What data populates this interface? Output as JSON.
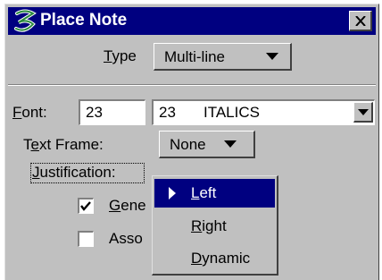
{
  "window": {
    "title": "Place Note",
    "brand_color": "#000080"
  },
  "type_row": {
    "label_accel": "T",
    "label_rest": "ype",
    "value": "Multi-line"
  },
  "font_row": {
    "label_accel": "F",
    "label_rest": "ont:",
    "number": "23",
    "font_number": "23",
    "font_name": "ITALICS"
  },
  "text_frame": {
    "label_pre": "T",
    "label_accel": "e",
    "label_rest": "xt Frame:",
    "value": "None"
  },
  "justification": {
    "label_accel": "J",
    "label_rest": "ustification:"
  },
  "checkboxes": [
    {
      "label_accel": "G",
      "label_rest": "ene",
      "checked": true
    },
    {
      "label_accel": "",
      "label_rest": "Asso",
      "checked": false
    }
  ],
  "menu": {
    "items": [
      {
        "accel": "L",
        "rest": "eft",
        "selected": true
      },
      {
        "accel": "R",
        "rest": "ight",
        "selected": false
      },
      {
        "accel": "D",
        "rest": "ynamic",
        "selected": false
      }
    ]
  },
  "icons": {
    "app": "microstation-logo-icon",
    "close": "close-icon",
    "dropdown": "chevron-down-icon",
    "check": "checkmark-icon",
    "menu_pointer": "triangle-right-icon"
  }
}
